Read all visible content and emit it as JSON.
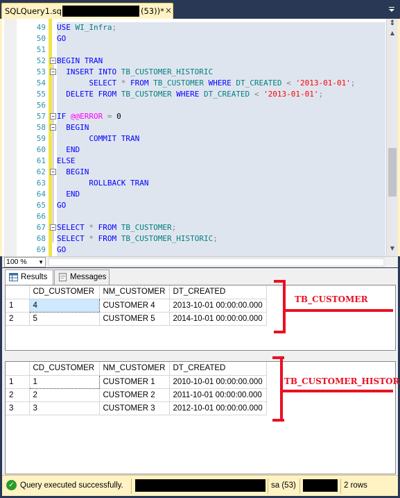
{
  "tab": {
    "title_prefix": "SQLQuery1.sql",
    "title_suffix": "(53))*",
    "close": "×"
  },
  "editor": {
    "lines": [
      {
        "n": "49",
        "tokens": [
          {
            "t": "USE ",
            "c": "kw"
          },
          {
            "t": "WI_Infra",
            "c": "id"
          },
          {
            "t": ";",
            "c": "gr"
          }
        ]
      },
      {
        "n": "50",
        "tokens": [
          {
            "t": "GO",
            "c": "kw"
          }
        ]
      },
      {
        "n": "51",
        "tokens": []
      },
      {
        "n": "52",
        "tokens": [
          {
            "t": "BEGIN TRAN",
            "c": "kw"
          }
        ]
      },
      {
        "n": "53",
        "tokens": [
          {
            "t": "  INSERT INTO ",
            "c": "kw"
          },
          {
            "t": "TB_CUSTOMER_HISTORIC",
            "c": "id"
          }
        ]
      },
      {
        "n": "54",
        "tokens": [
          {
            "t": "       SELECT ",
            "c": "kw"
          },
          {
            "t": "* ",
            "c": "gr"
          },
          {
            "t": "FROM ",
            "c": "kw"
          },
          {
            "t": "TB_CUSTOMER ",
            "c": "id"
          },
          {
            "t": "WHERE ",
            "c": "kw"
          },
          {
            "t": "DT_CREATED ",
            "c": "id"
          },
          {
            "t": "< ",
            "c": "gr"
          },
          {
            "t": "'2013-01-01'",
            "c": "str"
          },
          {
            "t": ";",
            "c": "gr"
          }
        ]
      },
      {
        "n": "55",
        "tokens": [
          {
            "t": "  DELETE FROM ",
            "c": "kw"
          },
          {
            "t": "TB_CUSTOMER ",
            "c": "id"
          },
          {
            "t": "WHERE ",
            "c": "kw"
          },
          {
            "t": "DT_CREATED ",
            "c": "id"
          },
          {
            "t": "< ",
            "c": "gr"
          },
          {
            "t": "'2013-01-01'",
            "c": "str"
          },
          {
            "t": ";",
            "c": "gr"
          }
        ]
      },
      {
        "n": "56",
        "tokens": []
      },
      {
        "n": "57",
        "tokens": [
          {
            "t": "IF ",
            "c": "kw"
          },
          {
            "t": "@@ERROR ",
            "c": "sys"
          },
          {
            "t": "= ",
            "c": "gr"
          },
          {
            "t": "0",
            "c": ""
          }
        ]
      },
      {
        "n": "58",
        "tokens": [
          {
            "t": "  BEGIN",
            "c": "kw"
          }
        ]
      },
      {
        "n": "59",
        "tokens": [
          {
            "t": "       COMMIT TRAN",
            "c": "kw"
          }
        ]
      },
      {
        "n": "60",
        "tokens": [
          {
            "t": "  END",
            "c": "kw"
          }
        ]
      },
      {
        "n": "61",
        "tokens": [
          {
            "t": "ELSE",
            "c": "kw"
          }
        ]
      },
      {
        "n": "62",
        "tokens": [
          {
            "t": "  BEGIN",
            "c": "kw"
          }
        ]
      },
      {
        "n": "63",
        "tokens": [
          {
            "t": "       ROLLBACK TRAN",
            "c": "kw"
          }
        ]
      },
      {
        "n": "64",
        "tokens": [
          {
            "t": "  END",
            "c": "kw"
          }
        ]
      },
      {
        "n": "65",
        "tokens": [
          {
            "t": "GO",
            "c": "kw"
          }
        ]
      },
      {
        "n": "66",
        "tokens": []
      },
      {
        "n": "67",
        "tokens": [
          {
            "t": "SELECT ",
            "c": "kw"
          },
          {
            "t": "* ",
            "c": "gr"
          },
          {
            "t": "FROM ",
            "c": "kw"
          },
          {
            "t": "TB_CUSTOMER",
            "c": "id"
          },
          {
            "t": ";",
            "c": "gr"
          }
        ]
      },
      {
        "n": "68",
        "tokens": [
          {
            "t": "SELECT ",
            "c": "kw"
          },
          {
            "t": "* ",
            "c": "gr"
          },
          {
            "t": "FROM ",
            "c": "kw"
          },
          {
            "t": "TB_CUSTOMER_HISTORIC",
            "c": "id"
          },
          {
            "t": ";",
            "c": "gr"
          }
        ]
      },
      {
        "n": "69",
        "tokens": [
          {
            "t": "GO",
            "c": "kw"
          }
        ]
      }
    ]
  },
  "zoom": {
    "value": "100 %"
  },
  "results_tabs": {
    "results": "Results",
    "messages": "Messages"
  },
  "grid1": {
    "columns": [
      "CD_CUSTOMER",
      "NM_CUSTOMER",
      "DT_CREATED"
    ],
    "rows": [
      [
        "1",
        "4",
        "CUSTOMER 4",
        "2013-10-01 00:00:00.000"
      ],
      [
        "2",
        "5",
        "CUSTOMER 5",
        "2014-10-01 00:00:00.000"
      ]
    ],
    "annotation": "TB_CUSTOMER"
  },
  "grid2": {
    "columns": [
      "CD_CUSTOMER",
      "NM_CUSTOMER",
      "DT_CREATED"
    ],
    "rows": [
      [
        "1",
        "1",
        "CUSTOMER 1",
        "2010-10-01 00:00:00.000"
      ],
      [
        "2",
        "2",
        "CUSTOMER 2",
        "2011-10-01 00:00:00.000"
      ],
      [
        "3",
        "3",
        "CUSTOMER 3",
        "2012-10-01 00:00:00.000"
      ]
    ],
    "annotation": "TB_CUSTOMER_HISTORIC"
  },
  "status": {
    "message": "Query executed successfully.",
    "user": "sa (53)",
    "rows": "2 rows"
  },
  "colors": {
    "accent_red": "#e81123",
    "keyword": "#0000ff",
    "identifier": "#008080",
    "string": "#ff0000",
    "status_bg": "#fff3c4"
  },
  "icons": {
    "results": "grid-icon",
    "messages": "messages-icon",
    "status": "check-icon"
  }
}
